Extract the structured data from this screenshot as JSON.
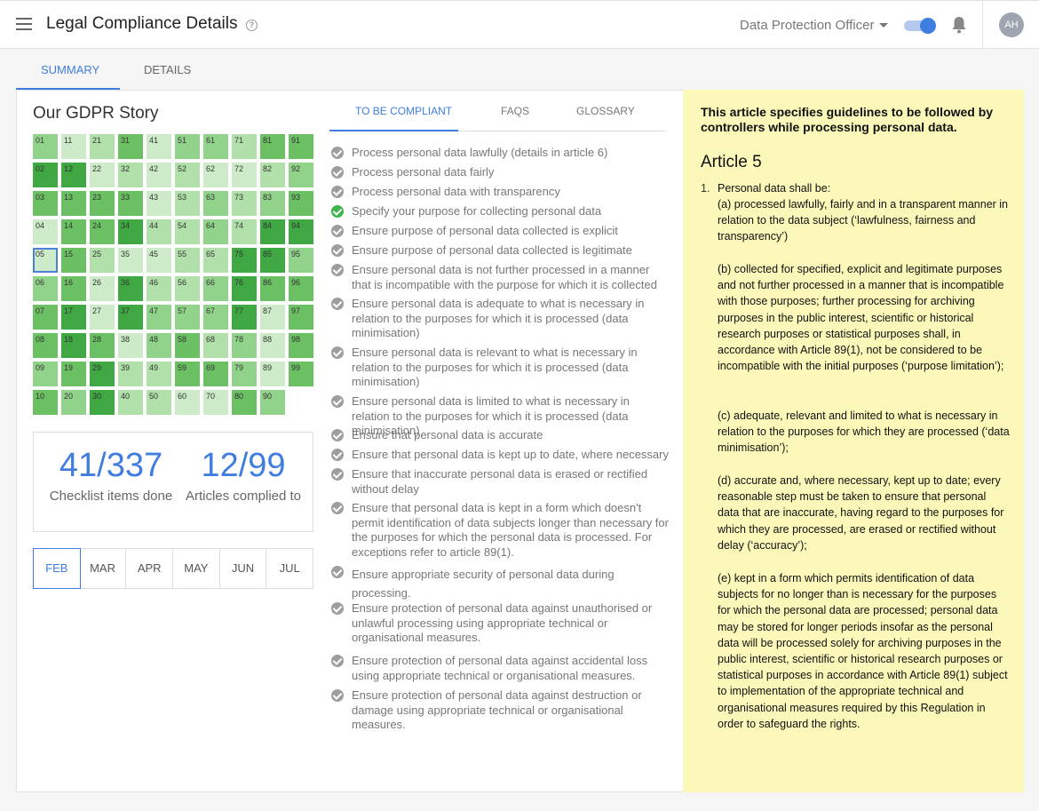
{
  "header": {
    "title": "Legal Compliance Details",
    "role": "Data Protection Officer",
    "avatar_initials": "AH",
    "toggle_on": true,
    "accent_color": "#3f7de0"
  },
  "main_tabs": [
    {
      "label": "SUMMARY",
      "active": true
    },
    {
      "label": "DETAILS",
      "active": false
    }
  ],
  "story": {
    "title": "Our GDPR Story",
    "selected_cell": "05",
    "cells": [
      {
        "label": "01",
        "shade": 3
      },
      {
        "label": "11",
        "shade": 1
      },
      {
        "label": "21",
        "shade": 2
      },
      {
        "label": "31",
        "shade": 4
      },
      {
        "label": "41",
        "shade": 1
      },
      {
        "label": "51",
        "shade": 3
      },
      {
        "label": "61",
        "shade": 3
      },
      {
        "label": "71",
        "shade": 2
      },
      {
        "label": "81",
        "shade": 4
      },
      {
        "label": "91",
        "shade": 4
      },
      {
        "label": "02",
        "shade": 5
      },
      {
        "label": "12",
        "shade": 5
      },
      {
        "label": "22",
        "shade": 1
      },
      {
        "label": "32",
        "shade": 2
      },
      {
        "label": "42",
        "shade": 1
      },
      {
        "label": "52",
        "shade": 2
      },
      {
        "label": "62",
        "shade": 1
      },
      {
        "label": "72",
        "shade": 1
      },
      {
        "label": "82",
        "shade": 2
      },
      {
        "label": "92",
        "shade": 3
      },
      {
        "label": "03",
        "shade": 4
      },
      {
        "label": "13",
        "shade": 4
      },
      {
        "label": "23",
        "shade": 4
      },
      {
        "label": "33",
        "shade": 4
      },
      {
        "label": "43",
        "shade": 1
      },
      {
        "label": "53",
        "shade": 2
      },
      {
        "label": "63",
        "shade": 3
      },
      {
        "label": "73",
        "shade": 2
      },
      {
        "label": "83",
        "shade": 3
      },
      {
        "label": "93",
        "shade": 4
      },
      {
        "label": "04",
        "shade": 1
      },
      {
        "label": "14",
        "shade": 4
      },
      {
        "label": "24",
        "shade": 4
      },
      {
        "label": "34",
        "shade": 5
      },
      {
        "label": "44",
        "shade": 2
      },
      {
        "label": "54",
        "shade": 2
      },
      {
        "label": "64",
        "shade": 3
      },
      {
        "label": "74",
        "shade": 2
      },
      {
        "label": "84",
        "shade": 5
      },
      {
        "label": "94",
        "shade": 5
      },
      {
        "label": "05",
        "shade": 1
      },
      {
        "label": "15",
        "shade": 4
      },
      {
        "label": "25",
        "shade": 2
      },
      {
        "label": "35",
        "shade": 1
      },
      {
        "label": "45",
        "shade": 1
      },
      {
        "label": "55",
        "shade": 2
      },
      {
        "label": "65",
        "shade": 2
      },
      {
        "label": "75",
        "shade": 5
      },
      {
        "label": "85",
        "shade": 5
      },
      {
        "label": "95",
        "shade": 3
      },
      {
        "label": "06",
        "shade": 3
      },
      {
        "label": "16",
        "shade": 4
      },
      {
        "label": "26",
        "shade": 1
      },
      {
        "label": "36",
        "shade": 5
      },
      {
        "label": "46",
        "shade": 2
      },
      {
        "label": "56",
        "shade": 2
      },
      {
        "label": "66",
        "shade": 3
      },
      {
        "label": "76",
        "shade": 5
      },
      {
        "label": "86",
        "shade": 4
      },
      {
        "label": "96",
        "shade": 4
      },
      {
        "label": "07",
        "shade": 4
      },
      {
        "label": "17",
        "shade": 5
      },
      {
        "label": "27",
        "shade": 1
      },
      {
        "label": "37",
        "shade": 5
      },
      {
        "label": "47",
        "shade": 3
      },
      {
        "label": "57",
        "shade": 3
      },
      {
        "label": "67",
        "shade": 3
      },
      {
        "label": "77",
        "shade": 5
      },
      {
        "label": "87",
        "shade": 1
      },
      {
        "label": "97",
        "shade": 4
      },
      {
        "label": "08",
        "shade": 4
      },
      {
        "label": "18",
        "shade": 5
      },
      {
        "label": "28",
        "shade": 4
      },
      {
        "label": "38",
        "shade": 1
      },
      {
        "label": "48",
        "shade": 3
      },
      {
        "label": "58",
        "shade": 4
      },
      {
        "label": "68",
        "shade": 2
      },
      {
        "label": "78",
        "shade": 3
      },
      {
        "label": "88",
        "shade": 1
      },
      {
        "label": "98",
        "shade": 4
      },
      {
        "label": "09",
        "shade": 3
      },
      {
        "label": "19",
        "shade": 4
      },
      {
        "label": "29",
        "shade": 5
      },
      {
        "label": "39",
        "shade": 2
      },
      {
        "label": "49",
        "shade": 2
      },
      {
        "label": "59",
        "shade": 4
      },
      {
        "label": "69",
        "shade": 4
      },
      {
        "label": "79",
        "shade": 3
      },
      {
        "label": "89",
        "shade": 1
      },
      {
        "label": "99",
        "shade": 4
      },
      {
        "label": "10",
        "shade": 4
      },
      {
        "label": "20",
        "shade": 3
      },
      {
        "label": "30",
        "shade": 5
      },
      {
        "label": "40",
        "shade": 2
      },
      {
        "label": "50",
        "shade": 2
      },
      {
        "label": "60",
        "shade": 1
      },
      {
        "label": "70",
        "shade": 1
      },
      {
        "label": "80",
        "shade": 4
      },
      {
        "label": "90",
        "shade": 3
      }
    ],
    "checklist_done": "41/337",
    "checklist_label": "Checklist items done",
    "articles_done": "12/99",
    "articles_label": "Articles complied to",
    "months": [
      {
        "label": "FEB",
        "active": true
      },
      {
        "label": "MAR",
        "active": false
      },
      {
        "label": "APR",
        "active": false
      },
      {
        "label": "MAY",
        "active": false
      },
      {
        "label": "JUN",
        "active": false
      },
      {
        "label": "JUL",
        "active": false
      }
    ]
  },
  "mid_tabs": [
    {
      "label": "TO BE COMPLIANT",
      "active": true
    },
    {
      "label": "FAQS",
      "active": false
    },
    {
      "label": "GLOSSARY",
      "active": false
    }
  ],
  "checklist": [
    {
      "text": "Process personal data lawfully (details in article 6)",
      "done": false
    },
    {
      "text": "Process personal data fairly",
      "done": false
    },
    {
      "text": "Process personal data with transparency",
      "done": false
    },
    {
      "text": "Specify your purpose for collecting personal data",
      "done": true
    },
    {
      "text": "Ensure purpose of personal data collected is explicit",
      "done": false
    },
    {
      "text": "Ensure purpose of personal data collected is legitimate",
      "done": false
    },
    {
      "text": "Ensure personal data is not further processed in a manner that is incompatible with the purpose for which it is collected",
      "done": false
    },
    {
      "text": "Ensure personal data is adequate to what is necessary in relation to the purposes for which it is processed (data minimisation)",
      "done": false
    },
    {
      "text": "Ensure personal data is relevant to what is necessary in relation to the purposes for which it is processed (data minimisation)",
      "done": false
    },
    {
      "text": "Ensure personal data is limited to what is necessary in relation to the purposes for which it is processed (data minimisation)",
      "done": false
    },
    {
      "text": "Ensure that personal data is accurate",
      "done": false
    },
    {
      "text": "Ensure that personal data is kept up to date, where necessary",
      "done": false
    },
    {
      "text": "Ensure that inaccurate personal data is erased or rectified without delay",
      "done": false
    },
    {
      "text": "Ensure that personal data is kept in a form which doesn't permit identification of data subjects longer than necessary for the purposes for which the personal data is processed. For exceptions refer to article 89(1).",
      "done": false
    },
    {
      "text": "Ensure appropriate security of personal data during processing.",
      "done": false
    },
    {
      "text": "Ensure protection of personal data against unauthorised or unlawful processing using appropriate technical or organisational measures.",
      "done": false
    },
    {
      "text": "Ensure protection of personal data against accidental loss using appropriate technical or organisational measures.",
      "done": false
    },
    {
      "text": "Ensure protection of personal data against destruction or damage using appropriate technical or organisational measures.",
      "done": false
    }
  ],
  "article": {
    "intro": "This article specifies guidelines to be followed by controllers while processing personal data.",
    "title": "Article 5",
    "number": "1.",
    "lead": "Personal data shall be:",
    "paragraphs": [
      "(a)  processed lawfully, fairly and in a transparent manner in relation to the data subject (‘lawfulness, fairness and transparency’)",
      "(b)  collected for specified, explicit and legitimate purposes and not further processed in a manner that is incompatible with those purposes; further processing for archiving purposes in the public interest, scientific or historical research purposes or statistical purposes shall, in accordance with Article 89(1), not be considered to be incompatible with the initial purposes (‘purpose limitation’);",
      "(c)  adequate, relevant and limited to what is necessary in relation to the purposes for which they are processed (‘data minimisation’);",
      "(d)  accurate and, where necessary, kept up to date; every reasonable step must be taken to ensure that personal data that are inaccurate, having regard to the purposes for which they are processed, are erased or rectified without delay (‘accuracy’);",
      "(e)  kept in a form which permits identification of data subjects for no longer than is necessary for the purposes for which the personal data are processed; personal data may be stored for longer periods insofar as the personal data will be processed solely for archiving purposes in the public interest, scientific or historical research purposes or statistical purposes in accordance with Article 89(1) subject to implementation of the appropriate technical and organisational measures required by this Regulation in order to safeguard the rights."
    ]
  }
}
